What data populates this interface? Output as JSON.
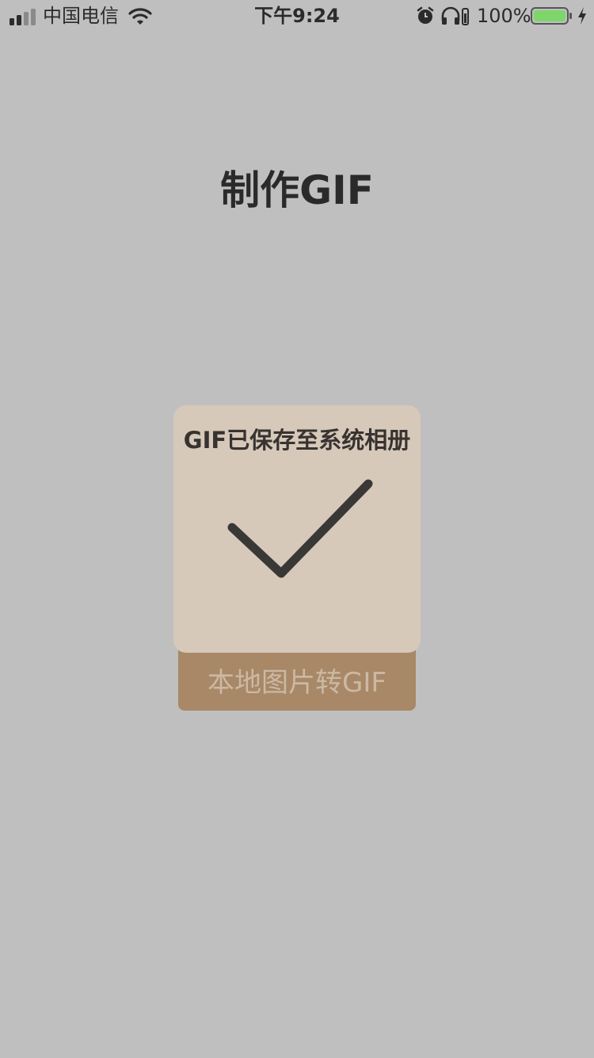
{
  "status_bar": {
    "carrier": "中国电信",
    "time": "下午9:24",
    "battery_percent": "100%",
    "signal_icon": "signal-bars-icon",
    "wifi_icon": "wifi-icon",
    "alarm_icon": "alarm-clock-icon",
    "headphones_icon": "headphones-icon",
    "battery_icon": "battery-icon",
    "charging_icon": "charging-bolt-icon",
    "battery_color": "#7ed66a"
  },
  "page": {
    "title": "制作GIF",
    "background": "#bfbfbf"
  },
  "main": {
    "convert_button_label": "本地图片转GIF",
    "convert_button_color": "#a88867"
  },
  "toast": {
    "message": "GIF已保存至系统相册",
    "icon": "checkmark-icon",
    "background": "#d6c9ba"
  }
}
